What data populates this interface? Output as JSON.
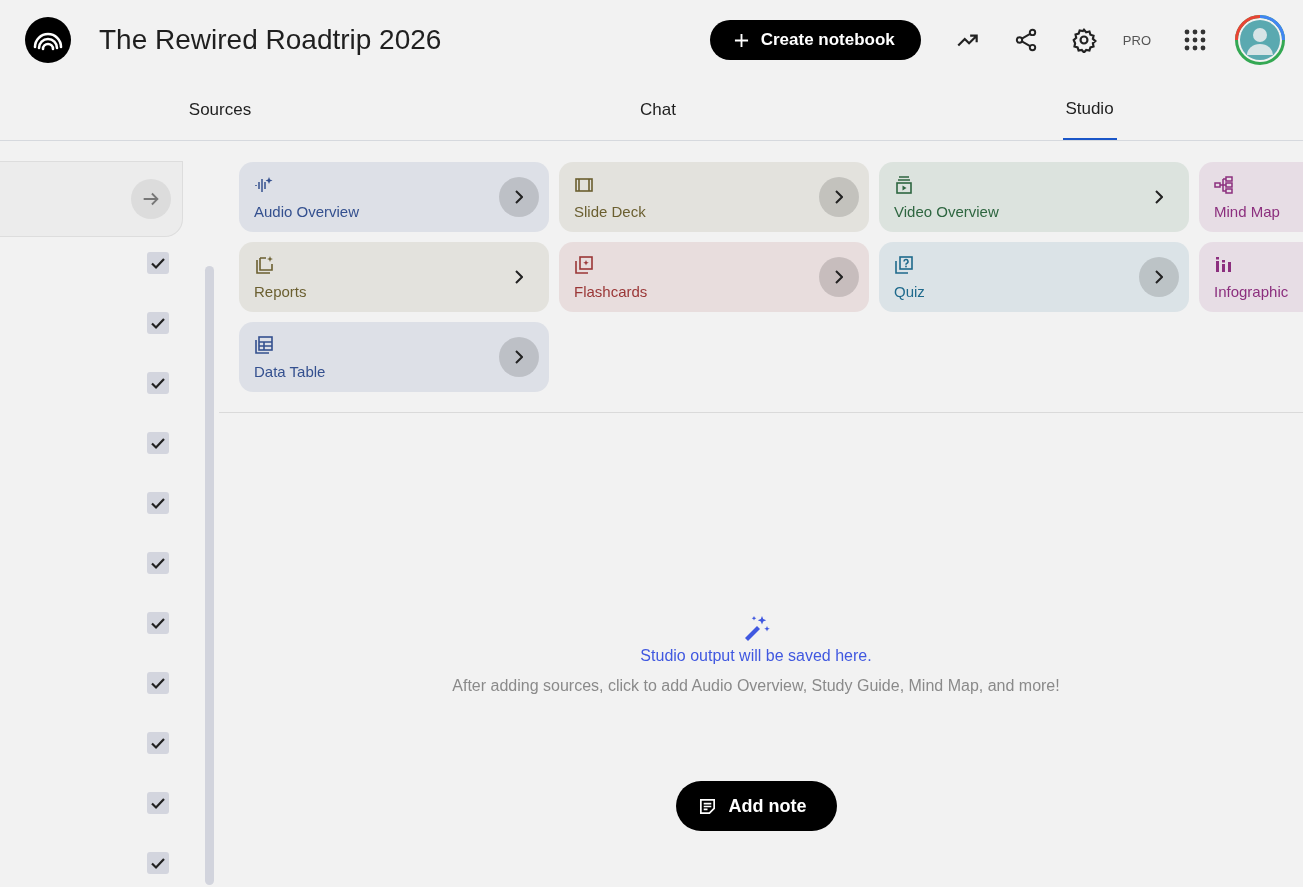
{
  "header": {
    "title": "The Rewired Roadtrip 2026",
    "create_button": "Create notebook",
    "plan_badge": "PRO"
  },
  "tabs": [
    {
      "label": "Sources",
      "selected": false
    },
    {
      "label": "Chat",
      "selected": false
    },
    {
      "label": "Studio",
      "selected": true
    }
  ],
  "sources": {
    "items": [
      {
        "checked": true
      },
      {
        "checked": true
      },
      {
        "checked": true
      },
      {
        "checked": true
      },
      {
        "checked": true
      },
      {
        "checked": true
      },
      {
        "checked": true
      },
      {
        "checked": true
      },
      {
        "checked": true
      },
      {
        "checked": true
      },
      {
        "checked": true
      }
    ]
  },
  "studio": {
    "cards": [
      {
        "kind": "audio",
        "label": "Audio Overview",
        "color": "#34508f",
        "arrow_background": true
      },
      {
        "kind": "slides",
        "label": "Slide Deck",
        "color": "#6b5f30",
        "arrow_background": true
      },
      {
        "kind": "video",
        "label": "Video Overview",
        "color": "#2e6640",
        "arrow_background": false
      },
      {
        "kind": "mindmap",
        "label": "Mind Map",
        "color": "#8c2f7e"
      },
      {
        "kind": "report",
        "label": "Reports",
        "color": "#6b5f30",
        "arrow_background": false
      },
      {
        "kind": "flashcards",
        "label": "Flashcards",
        "color": "#9a3636",
        "arrow_background": true
      },
      {
        "kind": "quiz",
        "label": "Quiz",
        "color": "#1f6a8c",
        "arrow_background": true
      },
      {
        "kind": "infographic",
        "label": "Infographic",
        "color": "#8c2f7e"
      },
      {
        "kind": "table",
        "label": "Data Table",
        "color": "#34508f",
        "arrow_background": true
      }
    ],
    "empty_title": "Studio output will be saved here.",
    "empty_text": "After adding sources, click to add Audio Overview, Study Guide, Mind Map, and more!",
    "add_note": "Add note"
  }
}
